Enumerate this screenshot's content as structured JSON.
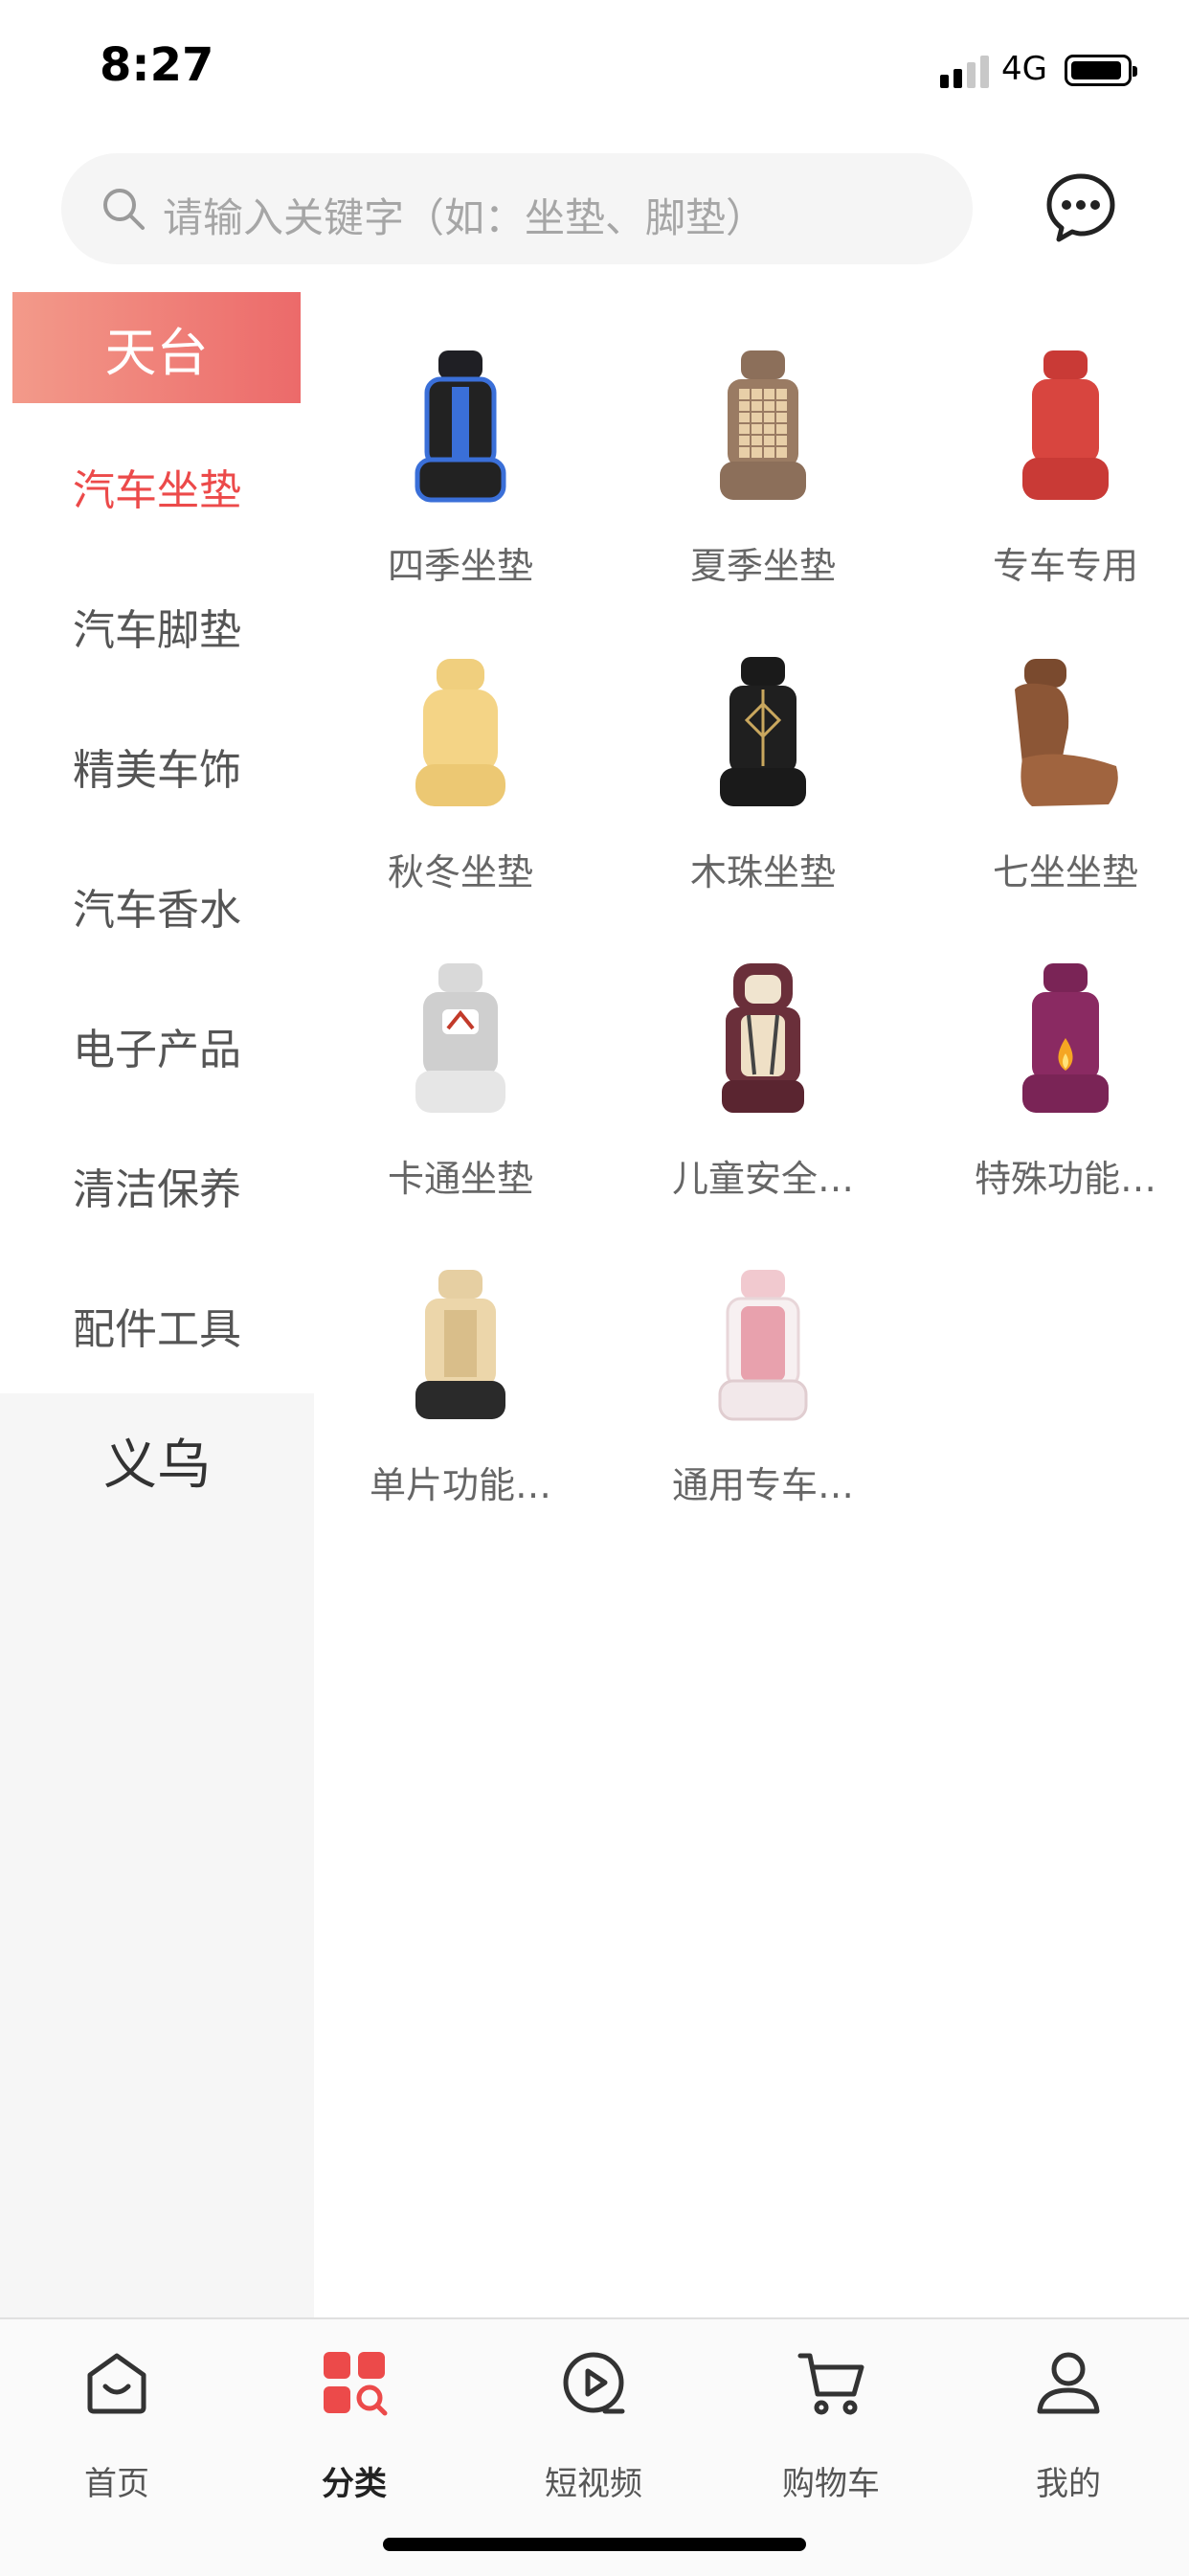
{
  "status_bar": {
    "time": "8:27",
    "network": "4G"
  },
  "search": {
    "placeholder": "请输入关键字（如：坐垫、脚垫）"
  },
  "sidebar": {
    "regions": [
      "天台",
      "义乌"
    ],
    "categories": [
      "汽车坐垫",
      "汽车脚垫",
      "精美车饰",
      "汽车香水",
      "电子产品",
      "清洁保养",
      "配件工具"
    ],
    "active_category": "汽车坐垫"
  },
  "grid": {
    "items": [
      {
        "label": "四季坐垫",
        "icon": "seat-cover-blue-icon"
      },
      {
        "label": "夏季坐垫",
        "icon": "seat-cover-bead-icon"
      },
      {
        "label": "专车专用",
        "icon": "seat-cover-red-icon"
      },
      {
        "label": "秋冬坐垫",
        "icon": "seat-cover-wool-icon"
      },
      {
        "label": "木珠坐垫",
        "icon": "seat-cover-wood-bead-icon"
      },
      {
        "label": "七坐坐垫",
        "icon": "seat-cover-leather-icon"
      },
      {
        "label": "卡通坐垫",
        "icon": "seat-cover-cartoon-icon"
      },
      {
        "label": "儿童安全…",
        "icon": "child-safety-seat-icon"
      },
      {
        "label": "特殊功能…",
        "icon": "heated-seat-cover-icon"
      },
      {
        "label": "单片功能…",
        "icon": "seat-cover-beige-icon"
      },
      {
        "label": "通用专车…",
        "icon": "seat-cover-pink-icon"
      }
    ]
  },
  "tab_bar": {
    "tabs": [
      {
        "label": "首页",
        "icon": "home-icon"
      },
      {
        "label": "分类",
        "icon": "category-icon"
      },
      {
        "label": "短视频",
        "icon": "play-video-icon"
      },
      {
        "label": "购物车",
        "icon": "cart-icon"
      },
      {
        "label": "我的",
        "icon": "profile-icon"
      }
    ],
    "active": "分类"
  },
  "colors": {
    "accent": "#ec4a4a",
    "region_tab_start": "#f39a8a",
    "region_tab_end": "#ec6a6a"
  }
}
